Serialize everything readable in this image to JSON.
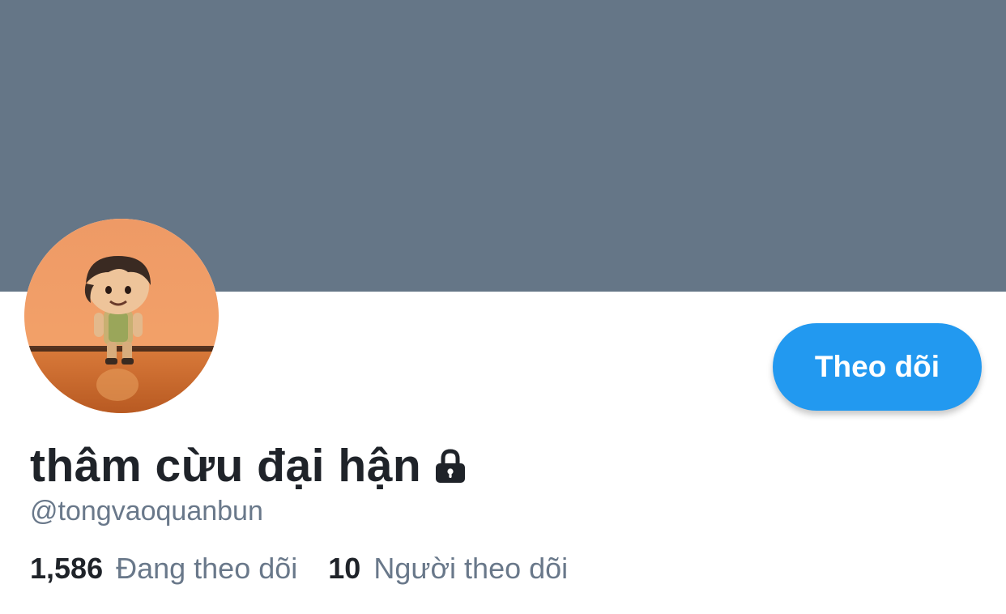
{
  "profile": {
    "display_name": "thâm cừu đại hận",
    "handle": "@tongvaoquanbun",
    "lock_icon": "lock-icon",
    "follow_button_label": "Theo dõi"
  },
  "stats": {
    "following_count": "1,586",
    "following_label": "Đang theo dõi",
    "followers_count": "10",
    "followers_label": "Người theo dõi"
  },
  "colors": {
    "banner": "#657687",
    "accent": "#2299f0",
    "name_text": "#1f2329",
    "secondary_text": "#69788a",
    "background": "#ffffff"
  }
}
